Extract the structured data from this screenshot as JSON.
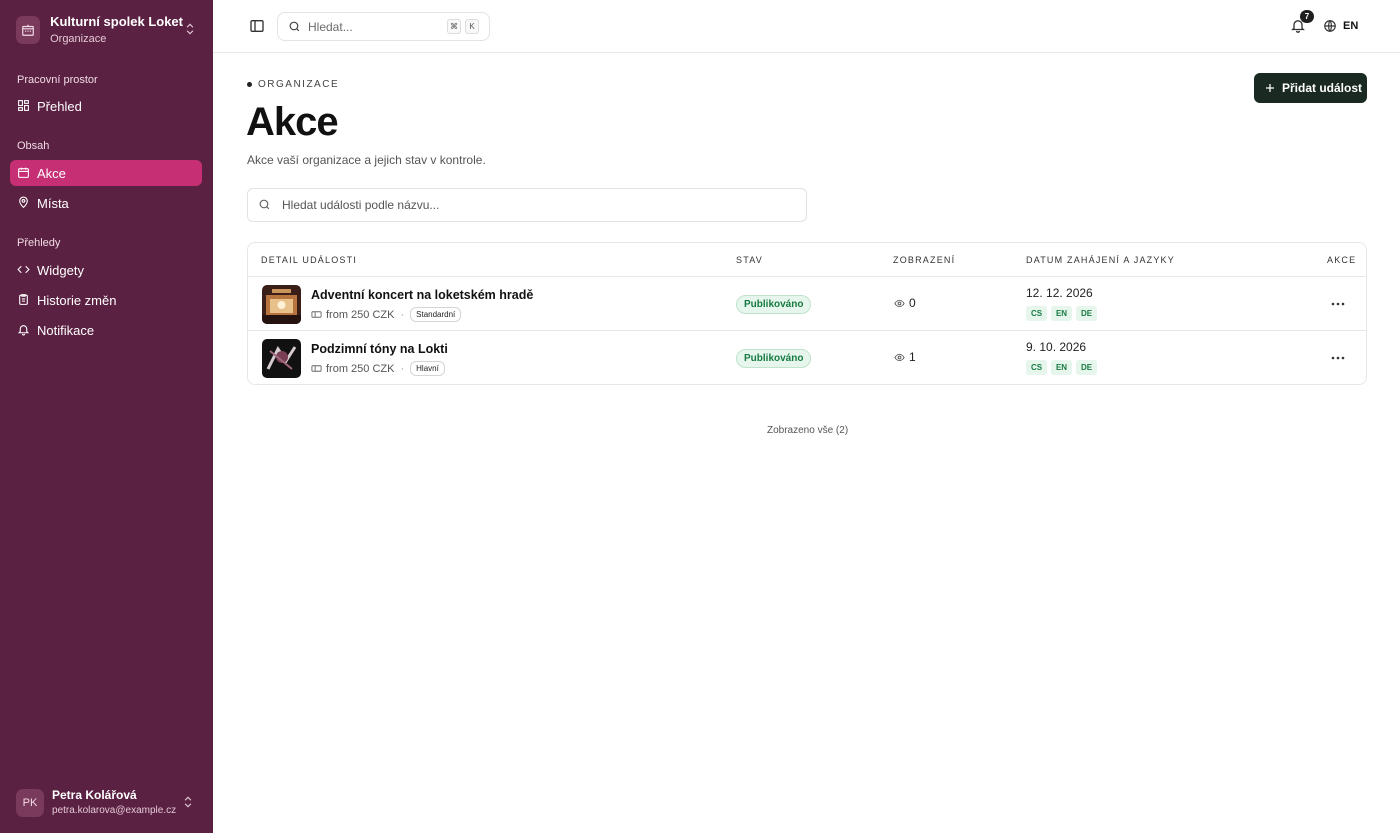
{
  "organization": {
    "name": "Kulturní spolek Loket",
    "subtitle": "Organizace"
  },
  "sidebar": {
    "groups": [
      {
        "label": "Pracovní prostor",
        "items": [
          {
            "label": "Přehled",
            "icon": "grid-icon"
          }
        ]
      },
      {
        "label": "Obsah",
        "items": [
          {
            "label": "Akce",
            "icon": "calendar-icon",
            "active": true
          },
          {
            "label": "Místa",
            "icon": "map-pin-icon"
          }
        ]
      },
      {
        "label": "Přehledy",
        "items": [
          {
            "label": "Widgety",
            "icon": "code-icon"
          },
          {
            "label": "Historie změn",
            "icon": "clipboard-icon"
          },
          {
            "label": "Notifikace",
            "icon": "bell-icon"
          }
        ]
      }
    ]
  },
  "user": {
    "initials": "PK",
    "name": "Petra Kolářová",
    "email": "petra.kolarova@example.cz"
  },
  "topbar": {
    "search_placeholder": "Hledat...",
    "shortcut": [
      "⌘",
      "K"
    ],
    "notifications_count": "7",
    "language": "EN"
  },
  "page": {
    "eyebrow": "ORGANIZACE",
    "title": "Akce",
    "description": "Akce vaší organizace a jejich stav v kontrole.",
    "add_button": "Přidat událost",
    "search_placeholder": "Hledat události podle názvu..."
  },
  "table": {
    "columns": [
      "DETAIL UDÁLOSTI",
      "STAV",
      "ZOBRAZENÍ",
      "DATUM ZAHÁJENÍ A JAZYKY",
      "AKCE"
    ],
    "rows": [
      {
        "title": "Adventní koncert na loketském hradě",
        "price": "from 250 CZK",
        "tag": "Standardní",
        "status": "Publikováno",
        "views": "0",
        "date": "12. 12. 2026",
        "languages": [
          "CS",
          "EN",
          "DE"
        ]
      },
      {
        "title": "Podzimní tóny na Lokti",
        "price": "from 250 CZK",
        "tag": "Hlavní",
        "status": "Publikováno",
        "views": "1",
        "date": "9. 10. 2026",
        "languages": [
          "CS",
          "EN",
          "DE"
        ]
      }
    ],
    "footer": "Zobrazeno vše (2)"
  },
  "colors": {
    "sidebar_bg": "#5b2142",
    "active_item": "#c72f74",
    "primary_button": "#1a2a22",
    "status_green": "#177a42"
  }
}
